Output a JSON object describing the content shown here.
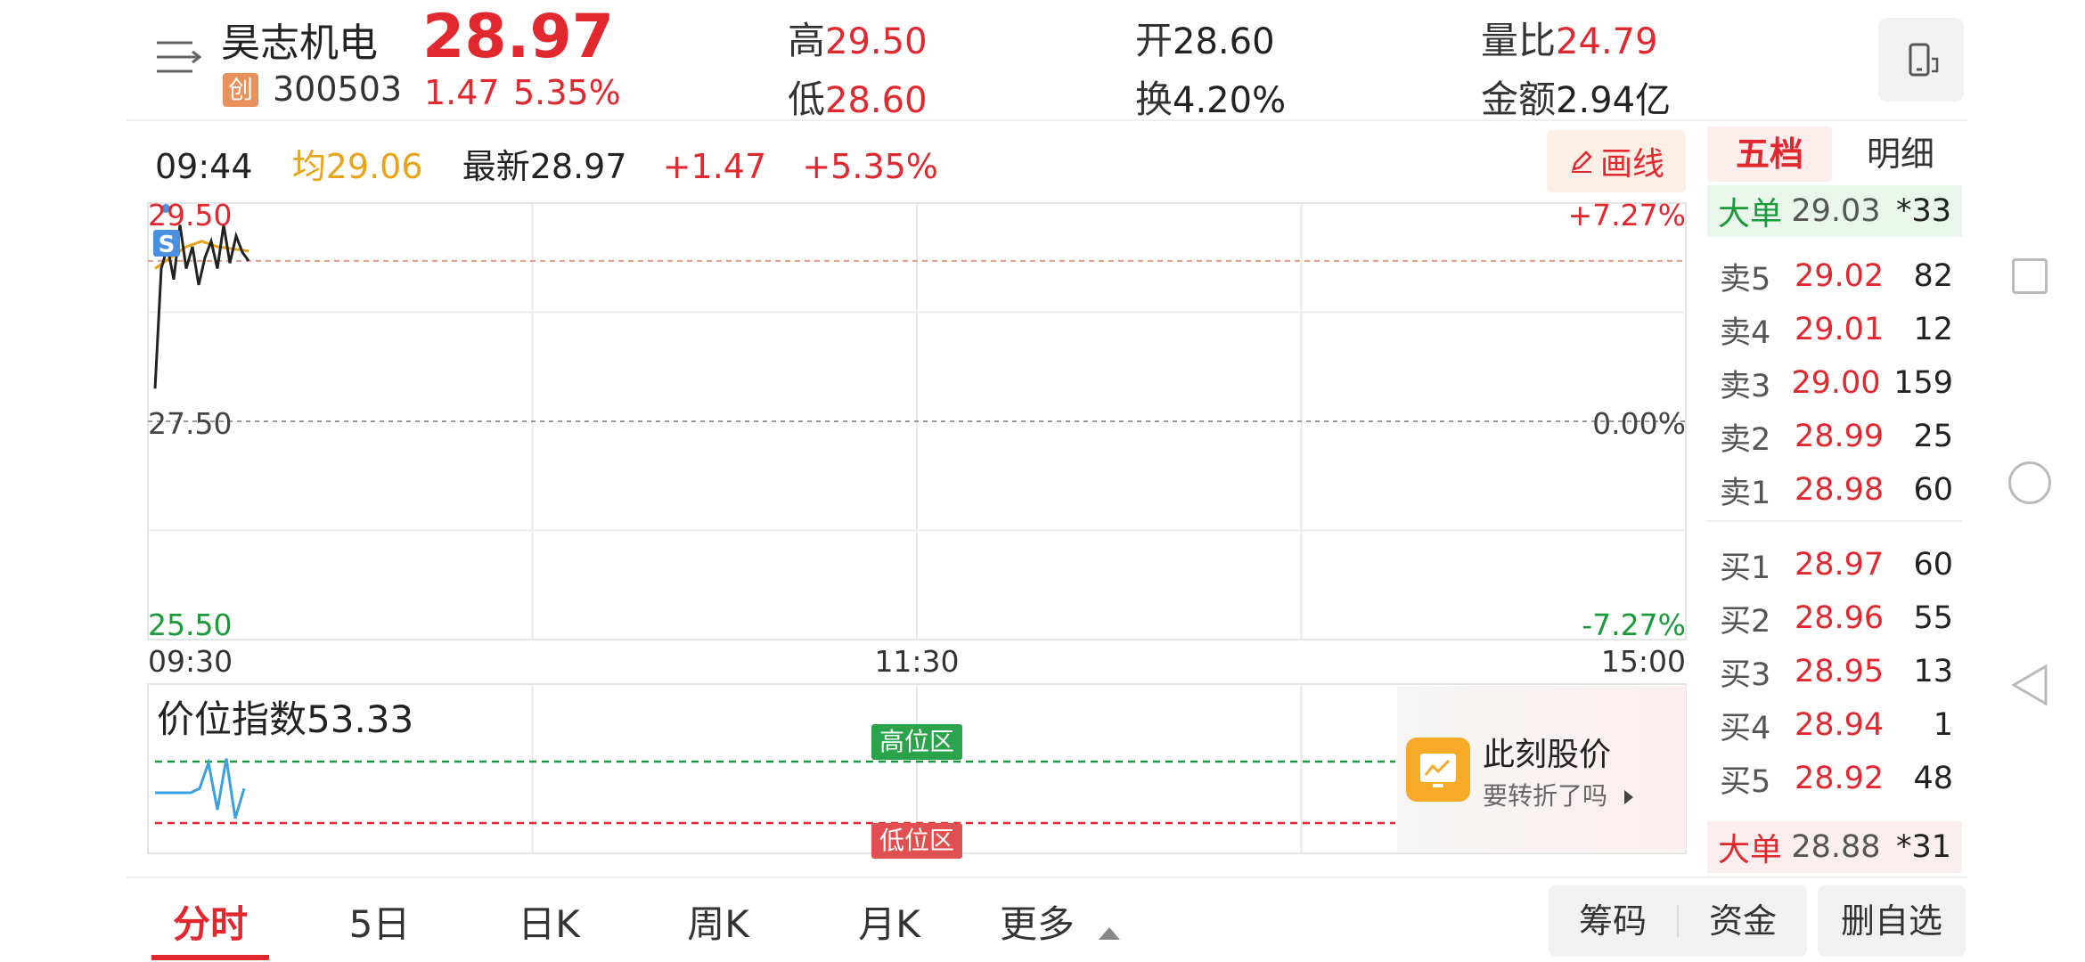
{
  "header": {
    "stock_name": "昊志机电",
    "board_badge": "创",
    "stock_code": "300503",
    "last_price": "28.97",
    "change": "1.47",
    "change_pct": "5.35%",
    "high_label": "高",
    "high_value": "29.50",
    "low_label": "低",
    "low_value": "28.60",
    "open_label": "开",
    "open_value": "28.60",
    "turnover_label": "换",
    "turnover_value": "4.20%",
    "volume_ratio_label": "量比",
    "volume_ratio_value": "24.79",
    "amount_label": "金额",
    "amount_value": "2.94亿"
  },
  "infobar": {
    "time": "09:44",
    "avg_label": "均",
    "avg_value": "29.06",
    "latest_label": "最新",
    "latest_value": "28.97",
    "change": "+1.47",
    "change_pct": "+5.35%",
    "draw_button": "画线"
  },
  "chart_data": {
    "type": "line",
    "title": "",
    "xlabel": "",
    "ylabel": "",
    "x_ticks": [
      "09:30",
      "11:30",
      "15:00"
    ],
    "y_ticks_left": [
      "29.50",
      "27.50",
      "25.50"
    ],
    "y_ticks_right": [
      "+7.27%",
      "0.00%",
      "-7.27%"
    ],
    "ylim": [
      25.5,
      29.5
    ],
    "prev_close": 27.5,
    "series": [
      {
        "values": [
          27.8,
          28.9,
          29.1,
          28.8,
          29.3,
          28.9,
          29.1,
          28.75,
          29.0,
          29.15,
          28.9,
          29.3,
          28.95,
          29.2,
          29.05,
          28.97
        ]
      }
    ],
    "avg_line": [
      28.9,
      29.0,
      29.1,
      29.15,
      29.1,
      29.08,
      29.06
    ],
    "marker": "S",
    "colors": {
      "price": "#222222",
      "avg": "#e8a317",
      "prev_close": "#999999",
      "latest_dashed": "#e59a8a"
    }
  },
  "indicator": {
    "label": "价位指数",
    "value": "53.33",
    "high_zone": "高位区",
    "low_zone": "低位区",
    "series": [
      0.5,
      0.5,
      0.5,
      0.5,
      0.5,
      0.55,
      0.85,
      0.3,
      0.9,
      0.2,
      0.55
    ],
    "colors": {
      "line": "#3aa0e0",
      "high": "#1a9a3a",
      "low": "#e0282e"
    }
  },
  "promo": {
    "title": "此刻股价",
    "subtitle": "要转折了吗"
  },
  "orderbook": {
    "tab_active": "五档",
    "tab_inactive": "明细",
    "big_top": {
      "label": "大单",
      "price": "29.03",
      "vol": "*33"
    },
    "asks": [
      {
        "label": "卖5",
        "price": "29.02",
        "vol": "82"
      },
      {
        "label": "卖4",
        "price": "29.01",
        "vol": "12"
      },
      {
        "label": "卖3",
        "price": "29.00",
        "vol": "159"
      },
      {
        "label": "卖2",
        "price": "28.99",
        "vol": "25"
      },
      {
        "label": "卖1",
        "price": "28.98",
        "vol": "60"
      }
    ],
    "bids": [
      {
        "label": "买1",
        "price": "28.97",
        "vol": "60"
      },
      {
        "label": "买2",
        "price": "28.96",
        "vol": "55"
      },
      {
        "label": "买3",
        "price": "28.95",
        "vol": "13"
      },
      {
        "label": "买4",
        "price": "28.94",
        "vol": "1"
      },
      {
        "label": "买5",
        "price": "28.92",
        "vol": "48"
      }
    ],
    "big_bottom": {
      "label": "大单",
      "price": "28.88",
      "vol": "*31"
    }
  },
  "tabs": {
    "items": [
      "分时",
      "5日",
      "日K",
      "周K",
      "月K",
      "更多"
    ],
    "active": 0
  },
  "actions": {
    "chips": "筹码",
    "funds": "资金",
    "remove_watch": "删自选"
  },
  "colors": {
    "up": "#e0282e",
    "down": "#1a9a3a",
    "accent": "#e0282e"
  }
}
